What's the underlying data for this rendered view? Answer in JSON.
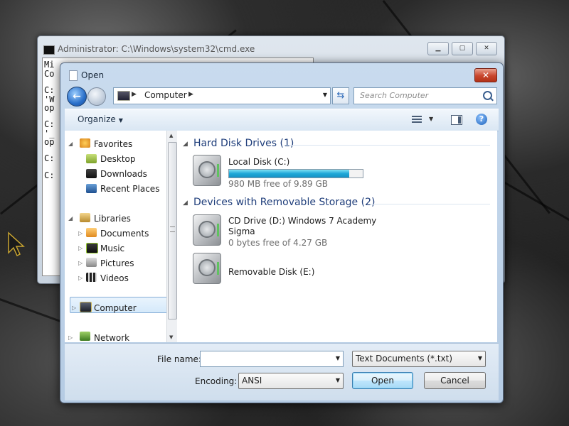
{
  "cmd_window": {
    "title": "Administrator: C:\\Windows\\system32\\cmd.exe",
    "console_lines": [
      "Mi",
      "Co",
      "",
      "C:",
      "'W",
      "op",
      "",
      "C:",
      "'_",
      "op",
      "",
      "C:",
      "",
      "C:"
    ]
  },
  "dialog": {
    "title": "Open",
    "close_label": "✕",
    "address": {
      "location": "Computer"
    },
    "search": {
      "placeholder": "Search Computer"
    },
    "toolbar": {
      "organize_label": "Organize",
      "help_label": "?"
    },
    "nav_pane": {
      "favorites": {
        "label": "Favorites",
        "items": [
          "Desktop",
          "Downloads",
          "Recent Places"
        ]
      },
      "libraries": {
        "label": "Libraries",
        "items": [
          "Documents",
          "Music",
          "Pictures",
          "Videos"
        ]
      },
      "computer_label": "Computer",
      "network_label": "Network"
    },
    "content": {
      "groups": [
        {
          "header": "Hard Disk Drives (1)",
          "items": [
            {
              "name": "Local Disk (C:)",
              "free": "980 MB free of 9.89 GB",
              "used_fraction": 0.9
            }
          ]
        },
        {
          "header": "Devices with Removable Storage (2)",
          "items": [
            {
              "name_line1": "CD Drive (D:) Windows 7 Academy",
              "name_line2": "Sigma",
              "free": "0 bytes free of 4.27 GB"
            },
            {
              "name": "Removable Disk (E:)"
            }
          ]
        }
      ]
    },
    "file_name": {
      "label": "File name:",
      "value": ""
    },
    "file_type": {
      "value": "Text Documents (*.txt)"
    },
    "encoding": {
      "label": "Encoding:",
      "value": "ANSI"
    },
    "buttons": {
      "open": "Open",
      "cancel": "Cancel"
    }
  }
}
